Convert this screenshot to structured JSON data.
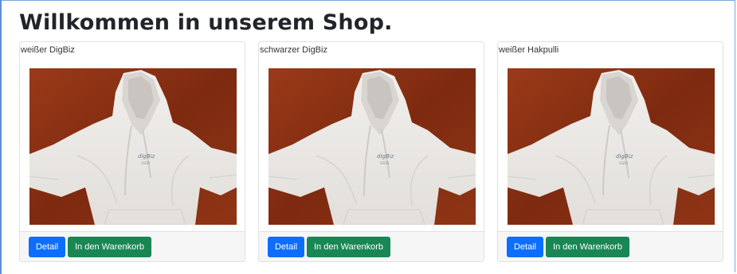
{
  "page": {
    "title": "Willkommen in unserem Shop."
  },
  "products": [
    {
      "name": "weißer DigBiz",
      "detail_label": "Detail",
      "cart_label": "In den Warenkorb",
      "image": "white-hoodie-photo"
    },
    {
      "name": "schwarzer DigBiz",
      "detail_label": "Detail",
      "cart_label": "In den Warenkorb",
      "image": "white-hoodie-photo"
    },
    {
      "name": "weißer Hakpulli",
      "detail_label": "Detail",
      "cart_label": "In den Warenkorb",
      "image": "white-hoodie-photo"
    }
  ],
  "colors": {
    "primary": "#0d6efd",
    "success": "#198754",
    "photo_background": "#8a2e12",
    "hoodie": "#ebe9e6"
  }
}
